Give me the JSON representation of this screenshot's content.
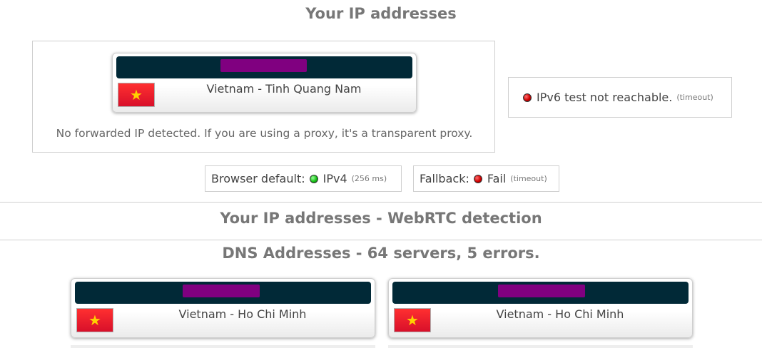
{
  "headings": {
    "ip_addresses": "Your IP addresses",
    "webrtc": "Your IP addresses - WebRTC detection",
    "dns": "DNS Addresses - 64 servers, 5 errors."
  },
  "ip_card": {
    "location": "Vietnam - Tinh Quang Nam",
    "flag": "vietnam-flag-icon",
    "ip_redacted": true
  },
  "forwarded_note": "No forwarded IP detected. If you are using a proxy, it's a transparent proxy.",
  "ipv6": {
    "status_icon": "red-status-dot",
    "text": "IPv6 test not reachable.",
    "detail": "(timeout)"
  },
  "browser_default": {
    "label": "Browser default:",
    "status_icon": "green-status-dot",
    "value": "IPv4",
    "detail": "(256 ms)"
  },
  "fallback": {
    "label": "Fallback:",
    "status_icon": "red-status-dot",
    "value": "Fail",
    "detail": "(timeout)"
  },
  "dns_servers": [
    {
      "location": "Vietnam - Ho Chi Minh",
      "flag": "vietnam-flag-icon",
      "ip_redacted": true
    },
    {
      "location": "Vietnam - Ho Chi Minh",
      "flag": "vietnam-flag-icon",
      "ip_redacted": true
    }
  ],
  "colors": {
    "ip_bar": "#012937",
    "redaction": "#800080",
    "heading_text": "#777777",
    "status_red": "#d00000",
    "status_green": "#18c018"
  }
}
